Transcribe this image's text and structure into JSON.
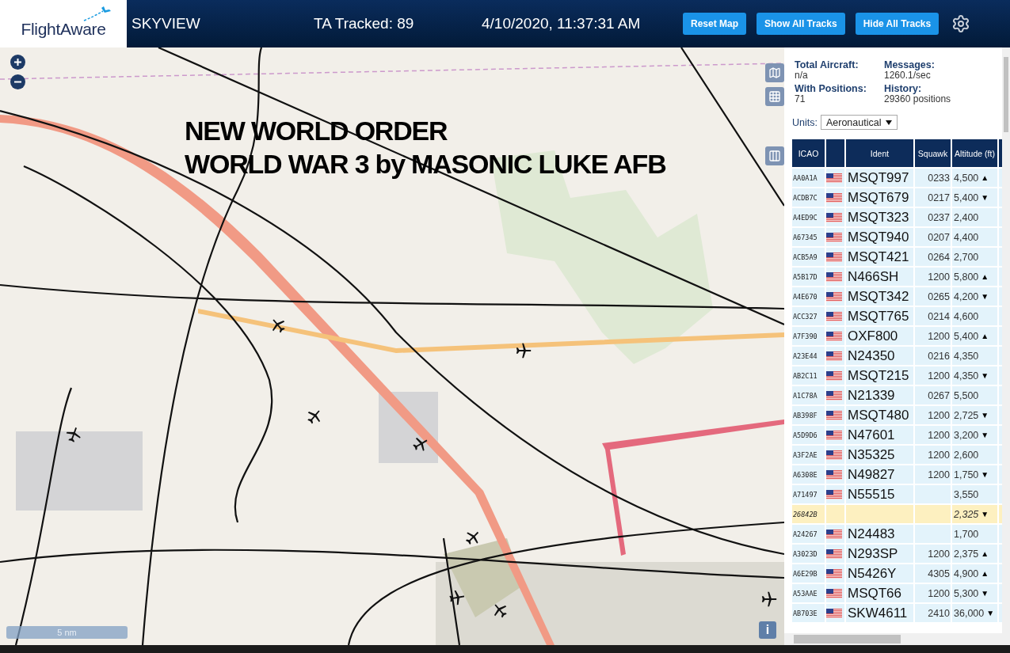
{
  "header": {
    "logo": "FlightAware",
    "title": "SKYVIEW",
    "tracked": "TA Tracked: 89",
    "datetime": "4/10/2020, 11:37:31 AM",
    "buttons": [
      "Reset Map",
      "Show All Tracks",
      "Hide All Tracks"
    ]
  },
  "map": {
    "kind": "picture",
    "caption": [
      "NEW WORLD ORDER",
      "WORLD WAR 3 by MASONIC LUKE AFB"
    ],
    "scale": "5 nm",
    "info": "i"
  },
  "stats": [
    {
      "label": "Total Aircraft:",
      "value": "n/a"
    },
    {
      "label": "Messages:",
      "value": "1260.1/sec"
    },
    {
      "label": "With Positions:",
      "value": "71"
    },
    {
      "label": "History:",
      "value": "29360 positions"
    }
  ],
  "units": {
    "label": "Units:",
    "value": "Aeronautical"
  },
  "table": {
    "columns": [
      "ICAO",
      "",
      "Ident",
      "Squawk",
      "Altitude (ft)"
    ],
    "rows": [
      {
        "icao": "AA0A1A",
        "flag": true,
        "ident": "MSQT997",
        "squawk": "0233",
        "altitude": "4,500",
        "trend": "▲",
        "highlighted": false
      },
      {
        "icao": "ACDB7C",
        "flag": true,
        "ident": "MSQT679",
        "squawk": "0217",
        "altitude": "5,400",
        "trend": "▼",
        "highlighted": false
      },
      {
        "icao": "A4ED9C",
        "flag": true,
        "ident": "MSQT323",
        "squawk": "0237",
        "altitude": "2,400",
        "trend": "",
        "highlighted": false
      },
      {
        "icao": "A67345",
        "flag": true,
        "ident": "MSQT940",
        "squawk": "0207",
        "altitude": "4,400",
        "trend": "",
        "highlighted": false
      },
      {
        "icao": "ACB5A9",
        "flag": true,
        "ident": "MSQT421",
        "squawk": "0264",
        "altitude": "2,700",
        "trend": "",
        "highlighted": false
      },
      {
        "icao": "A5B17D",
        "flag": true,
        "ident": "N466SH",
        "squawk": "1200",
        "altitude": "5,800",
        "trend": "▲",
        "highlighted": false
      },
      {
        "icao": "A4E670",
        "flag": true,
        "ident": "MSQT342",
        "squawk": "0265",
        "altitude": "4,200",
        "trend": "▼",
        "highlighted": false
      },
      {
        "icao": "ACC327",
        "flag": true,
        "ident": "MSQT765",
        "squawk": "0214",
        "altitude": "4,600",
        "trend": "",
        "highlighted": false
      },
      {
        "icao": "A7F390",
        "flag": true,
        "ident": "OXF800",
        "squawk": "1200",
        "altitude": "5,400",
        "trend": "▲",
        "highlighted": false
      },
      {
        "icao": "A23E44",
        "flag": true,
        "ident": "N24350",
        "squawk": "0216",
        "altitude": "4,350",
        "trend": "",
        "highlighted": false
      },
      {
        "icao": "AB2C11",
        "flag": true,
        "ident": "MSQT215",
        "squawk": "1200",
        "altitude": "4,350",
        "trend": "▼",
        "highlighted": false
      },
      {
        "icao": "A1C78A",
        "flag": true,
        "ident": "N21339",
        "squawk": "0267",
        "altitude": "5,500",
        "trend": "",
        "highlighted": false
      },
      {
        "icao": "AB398F",
        "flag": true,
        "ident": "MSQT480",
        "squawk": "1200",
        "altitude": "2,725",
        "trend": "▼",
        "highlighted": false
      },
      {
        "icao": "A5D9D6",
        "flag": true,
        "ident": "N47601",
        "squawk": "1200",
        "altitude": "3,200",
        "trend": "▼",
        "highlighted": false
      },
      {
        "icao": "A3F2AE",
        "flag": true,
        "ident": "N35325",
        "squawk": "1200",
        "altitude": "2,600",
        "trend": "",
        "highlighted": false
      },
      {
        "icao": "A6308E",
        "flag": true,
        "ident": "N49827",
        "squawk": "1200",
        "altitude": "1,750",
        "trend": "▼",
        "highlighted": false
      },
      {
        "icao": "A71497",
        "flag": true,
        "ident": "N55515",
        "squawk": "",
        "altitude": "3,550",
        "trend": "",
        "highlighted": false
      },
      {
        "icao": "26842B",
        "flag": false,
        "ident": "",
        "squawk": "",
        "altitude": "2,325",
        "trend": "▼",
        "highlighted": true
      },
      {
        "icao": "A24267",
        "flag": true,
        "ident": "N24483",
        "squawk": "",
        "altitude": "1,700",
        "trend": "",
        "highlighted": false
      },
      {
        "icao": "A3023D",
        "flag": true,
        "ident": "N293SP",
        "squawk": "1200",
        "altitude": "2,375",
        "trend": "▲",
        "highlighted": false
      },
      {
        "icao": "A6E29B",
        "flag": true,
        "ident": "N5426Y",
        "squawk": "4305",
        "altitude": "4,900",
        "trend": "▲",
        "highlighted": false
      },
      {
        "icao": "A53AAE",
        "flag": true,
        "ident": "MSQT66",
        "squawk": "1200",
        "altitude": "5,300",
        "trend": "▼",
        "highlighted": false
      },
      {
        "icao": "AB703E",
        "flag": true,
        "ident": "SKW4611",
        "squawk": "2410",
        "altitude": "36,000",
        "trend": "▼",
        "highlighted": false
      }
    ]
  }
}
